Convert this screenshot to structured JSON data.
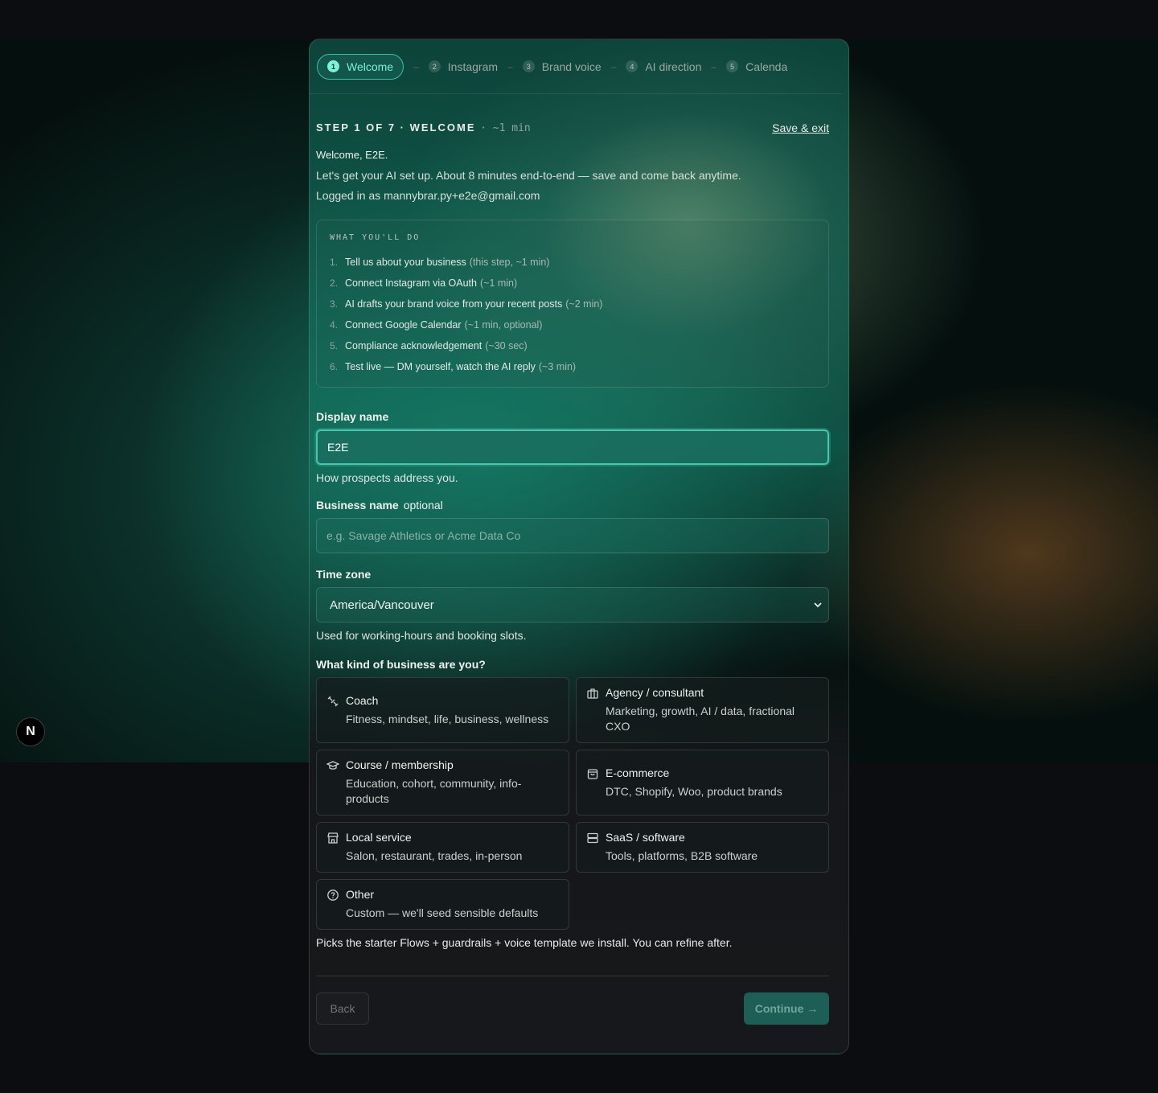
{
  "stepper": [
    {
      "num": "1",
      "label": "Welcome"
    },
    {
      "num": "2",
      "label": "Instagram"
    },
    {
      "num": "3",
      "label": "Brand voice"
    },
    {
      "num": "4",
      "label": "AI direction"
    },
    {
      "num": "5",
      "label": "Calenda"
    }
  ],
  "stepper_sep": "–",
  "header": {
    "step_label": "STEP 1 OF 7 · WELCOME",
    "duration": "· ~1 min",
    "save_exit": "Save & exit"
  },
  "intro": {
    "welcome": "Welcome, E2E.",
    "body": "Let's get your AI set up. About 8 minutes end-to-end — save and come back anytime.",
    "logged_in": "Logged in as mannybrar.py+e2e@gmail.com"
  },
  "todo": {
    "title": "WHAT YOU'LL DO",
    "items": [
      {
        "n": "1.",
        "text": "Tell us about your business",
        "hint": "(this step, ~1 min)"
      },
      {
        "n": "2.",
        "text": "Connect Instagram via OAuth",
        "hint": "(~1 min)"
      },
      {
        "n": "3.",
        "text": "AI drafts your brand voice from your recent posts",
        "hint": "(~2 min)"
      },
      {
        "n": "4.",
        "text": "Connect Google Calendar",
        "hint": "(~1 min, optional)"
      },
      {
        "n": "5.",
        "text": "Compliance acknowledgement",
        "hint": "(~30 sec)"
      },
      {
        "n": "6.",
        "text": "Test live — DM yourself, watch the AI reply",
        "hint": "(~3 min)"
      }
    ]
  },
  "form": {
    "display_name": {
      "label": "Display name",
      "value": "E2E",
      "help": "How prospects address you."
    },
    "business_name": {
      "label": "Business name",
      "optional": "optional",
      "placeholder": "e.g. Savage Athletics or Acme Data Co"
    },
    "time_zone": {
      "label": "Time zone",
      "value": "America/Vancouver",
      "help": "Used for working-hours and booking slots."
    },
    "business_type": {
      "label": "What kind of business are you?",
      "options": [
        {
          "icon": "coach-icon",
          "title": "Coach",
          "desc": "Fitness, mindset, life, business, wellness"
        },
        {
          "icon": "briefcase-icon",
          "title": "Agency / consultant",
          "desc": "Marketing, growth, AI / data, fractional CXO"
        },
        {
          "icon": "graduation-cap-icon",
          "title": "Course / membership",
          "desc": "Education, cohort, community, info-products"
        },
        {
          "icon": "shopping-bag-icon",
          "title": "E-commerce",
          "desc": "DTC, Shopify, Woo, product brands"
        },
        {
          "icon": "store-icon",
          "title": "Local service",
          "desc": "Salon, restaurant, trades, in-person"
        },
        {
          "icon": "server-icon",
          "title": "SaaS / software",
          "desc": "Tools, platforms, B2B software"
        },
        {
          "icon": "help-circle-icon",
          "title": "Other",
          "desc": "Custom — we'll seed sensible defaults"
        }
      ],
      "help": "Picks the starter Flows + guardrails + voice template we install. You can refine after."
    }
  },
  "footer": {
    "back": "Back",
    "continue": "Continue →"
  },
  "badge": "N"
}
